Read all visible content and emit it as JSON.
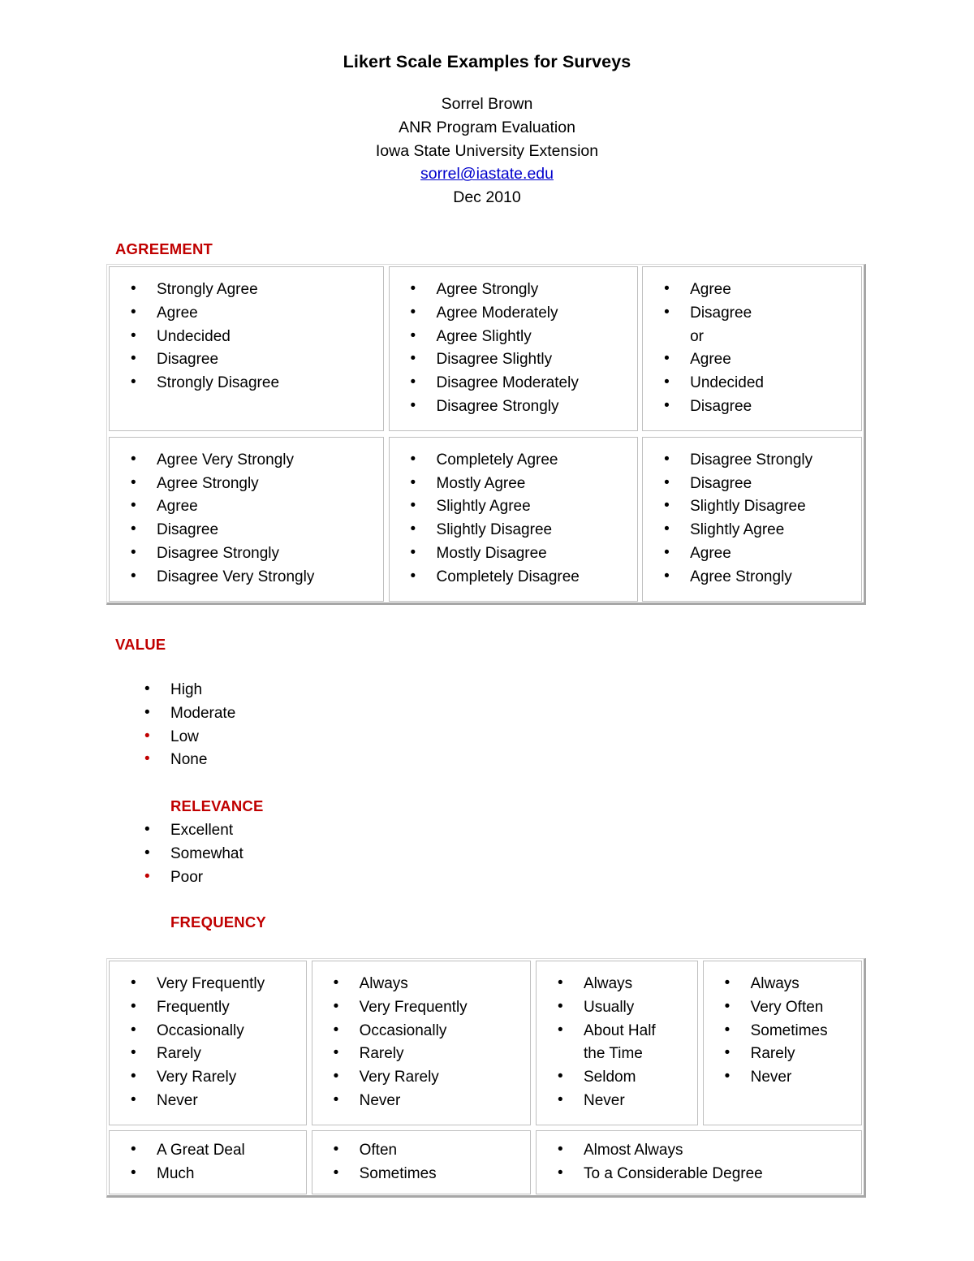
{
  "document": {
    "title": "Likert Scale Examples for Surveys",
    "author": "Sorrel Brown",
    "program": "ANR Program Evaluation",
    "institution": "Iowa State University Extension",
    "email": "sorrel@iastate.edu",
    "date": "Dec 2010"
  },
  "colors": {
    "heading_red": "#C00000",
    "link_blue": "#0000CC",
    "table_border": "#BFBFBF",
    "table_shadow": "#A6A6A6"
  },
  "sections": {
    "agreement": {
      "heading": "AGREEMENT",
      "table": {
        "rows": [
          {
            "cells": [
              {
                "items": [
                  {
                    "text": "Strongly Agree",
                    "bullet": true,
                    "bullet_color": "#000000"
                  },
                  {
                    "text": "Agree",
                    "bullet": true,
                    "bullet_color": "#000000"
                  },
                  {
                    "text": "Undecided",
                    "bullet": true,
                    "bullet_color": "#000000"
                  },
                  {
                    "text": "Disagree",
                    "bullet": true,
                    "bullet_color": "#000000"
                  },
                  {
                    "text": "Strongly Disagree",
                    "bullet": true,
                    "bullet_color": "#000000"
                  }
                ]
              },
              {
                "items": [
                  {
                    "text": "Agree Strongly",
                    "bullet": true,
                    "bullet_color": "#000000"
                  },
                  {
                    "text": "Agree Moderately",
                    "bullet": true,
                    "bullet_color": "#000000"
                  },
                  {
                    "text": "Agree Slightly",
                    "bullet": true,
                    "bullet_color": "#000000"
                  },
                  {
                    "text": "Disagree Slightly",
                    "bullet": true,
                    "bullet_color": "#000000"
                  },
                  {
                    "text": "Disagree Moderately",
                    "bullet": true,
                    "bullet_color": "#000000"
                  },
                  {
                    "text": "Disagree Strongly",
                    "bullet": true,
                    "bullet_color": "#000000"
                  }
                ]
              },
              {
                "items": [
                  {
                    "text": "Agree",
                    "bullet": true,
                    "bullet_color": "#000000"
                  },
                  {
                    "text": "Disagree",
                    "bullet": true,
                    "bullet_color": "#000000"
                  },
                  {
                    "text": "or",
                    "bullet": false,
                    "bullet_color": "#000000"
                  },
                  {
                    "text": "Agree",
                    "bullet": true,
                    "bullet_color": "#000000"
                  },
                  {
                    "text": "Undecided",
                    "bullet": true,
                    "bullet_color": "#000000"
                  },
                  {
                    "text": "Disagree",
                    "bullet": true,
                    "bullet_color": "#000000"
                  }
                ]
              }
            ]
          },
          {
            "cells": [
              {
                "items": [
                  {
                    "text": "Agree Very Strongly",
                    "bullet": true,
                    "bullet_color": "#000000"
                  },
                  {
                    "text": "Agree Strongly",
                    "bullet": true,
                    "bullet_color": "#000000"
                  },
                  {
                    "text": "Agree",
                    "bullet": true,
                    "bullet_color": "#000000"
                  },
                  {
                    "text": "Disagree",
                    "bullet": true,
                    "bullet_color": "#000000"
                  },
                  {
                    "text": "Disagree Strongly",
                    "bullet": true,
                    "bullet_color": "#000000"
                  },
                  {
                    "text": "Disagree Very Strongly",
                    "bullet": true,
                    "bullet_color": "#000000"
                  }
                ]
              },
              {
                "items": [
                  {
                    "text": "Completely Agree",
                    "bullet": true,
                    "bullet_color": "#000000"
                  },
                  {
                    "text": "Mostly Agree",
                    "bullet": true,
                    "bullet_color": "#000000"
                  },
                  {
                    "text": "Slightly Agree",
                    "bullet": true,
                    "bullet_color": "#000000"
                  },
                  {
                    "text": "Slightly Disagree",
                    "bullet": true,
                    "bullet_color": "#000000"
                  },
                  {
                    "text": "Mostly Disagree",
                    "bullet": true,
                    "bullet_color": "#000000"
                  },
                  {
                    "text": "Completely Disagree",
                    "bullet": true,
                    "bullet_color": "#000000"
                  }
                ]
              },
              {
                "items": [
                  {
                    "text": "Disagree Strongly",
                    "bullet": true,
                    "bullet_color": "#000000"
                  },
                  {
                    "text": "Disagree",
                    "bullet": true,
                    "bullet_color": "#000000"
                  },
                  {
                    "text": "Slightly Disagree",
                    "bullet": true,
                    "bullet_color": "#000000"
                  },
                  {
                    "text": "Slightly Agree",
                    "bullet": true,
                    "bullet_color": "#000000"
                  },
                  {
                    "text": "Agree",
                    "bullet": true,
                    "bullet_color": "#000000"
                  },
                  {
                    "text": "Agree Strongly",
                    "bullet": true,
                    "bullet_color": "#000000"
                  }
                ]
              }
            ]
          }
        ]
      }
    },
    "value": {
      "heading": "VALUE",
      "items": [
        {
          "text": "High",
          "bullet": true,
          "bullet_color": "#000000"
        },
        {
          "text": "Moderate",
          "bullet": true,
          "bullet_color": "#000000"
        },
        {
          "text": "Low",
          "bullet": true,
          "bullet_color": "#C00000"
        },
        {
          "text": "None",
          "bullet": true,
          "bullet_color": "#C00000"
        }
      ]
    },
    "relevance": {
      "heading": "RELEVANCE",
      "items": [
        {
          "text": "Excellent",
          "bullet": true,
          "bullet_color": "#000000"
        },
        {
          "text": "Somewhat",
          "bullet": true,
          "bullet_color": "#000000"
        },
        {
          "text": "Poor",
          "bullet": true,
          "bullet_color": "#C00000"
        }
      ]
    },
    "frequency": {
      "heading": "FREQUENCY",
      "table": {
        "rows": [
          {
            "cells": [
              {
                "items": [
                  {
                    "text": "Very Frequently",
                    "bullet": true,
                    "bullet_color": "#000000"
                  },
                  {
                    "text": "Frequently",
                    "bullet": true,
                    "bullet_color": "#000000"
                  },
                  {
                    "text": "Occasionally",
                    "bullet": true,
                    "bullet_color": "#000000"
                  },
                  {
                    "text": "Rarely",
                    "bullet": true,
                    "bullet_color": "#000000"
                  },
                  {
                    "text": "Very Rarely",
                    "bullet": true,
                    "bullet_color": "#000000"
                  },
                  {
                    "text": "Never",
                    "bullet": true,
                    "bullet_color": "#000000"
                  }
                ]
              },
              {
                "items": [
                  {
                    "text": "Always",
                    "bullet": true,
                    "bullet_color": "#000000"
                  },
                  {
                    "text": "Very Frequently",
                    "bullet": true,
                    "bullet_color": "#000000"
                  },
                  {
                    "text": "Occasionally",
                    "bullet": true,
                    "bullet_color": "#000000"
                  },
                  {
                    "text": "Rarely",
                    "bullet": true,
                    "bullet_color": "#000000"
                  },
                  {
                    "text": "Very Rarely",
                    "bullet": true,
                    "bullet_color": "#000000"
                  },
                  {
                    "text": "Never",
                    "bullet": true,
                    "bullet_color": "#000000"
                  }
                ]
              },
              {
                "items": [
                  {
                    "text": "Always",
                    "bullet": true,
                    "bullet_color": "#000000"
                  },
                  {
                    "text": "Usually",
                    "bullet": true,
                    "bullet_color": "#000000"
                  },
                  {
                    "text": "About Half",
                    "bullet": true,
                    "bullet_color": "#000000"
                  },
                  {
                    "text": "the Time",
                    "bullet": false,
                    "bullet_color": "#000000"
                  },
                  {
                    "text": "Seldom",
                    "bullet": true,
                    "bullet_color": "#000000"
                  },
                  {
                    "text": "Never",
                    "bullet": true,
                    "bullet_color": "#000000"
                  }
                ]
              },
              {
                "items": [
                  {
                    "text": "Always",
                    "bullet": true,
                    "bullet_color": "#000000"
                  },
                  {
                    "text": "Very Often",
                    "bullet": true,
                    "bullet_color": "#000000"
                  },
                  {
                    "text": "Sometimes",
                    "bullet": true,
                    "bullet_color": "#000000"
                  },
                  {
                    "text": "Rarely",
                    "bullet": true,
                    "bullet_color": "#000000"
                  },
                  {
                    "text": "Never",
                    "bullet": true,
                    "bullet_color": "#000000"
                  }
                ]
              }
            ]
          },
          {
            "cells": [
              {
                "items": [
                  {
                    "text": "A Great Deal",
                    "bullet": true,
                    "bullet_color": "#000000"
                  },
                  {
                    "text": "Much",
                    "bullet": true,
                    "bullet_color": "#000000"
                  }
                ]
              },
              {
                "items": [
                  {
                    "text": "Often",
                    "bullet": true,
                    "bullet_color": "#000000"
                  },
                  {
                    "text": "Sometimes",
                    "bullet": true,
                    "bullet_color": "#000000"
                  }
                ]
              },
              {
                "items": [
                  {
                    "text": "Almost Always",
                    "bullet": true,
                    "bullet_color": "#000000"
                  },
                  {
                    "text": "To a Considerable Degree",
                    "bullet": true,
                    "bullet_color": "#000000"
                  }
                ]
              }
            ]
          }
        ]
      }
    }
  }
}
